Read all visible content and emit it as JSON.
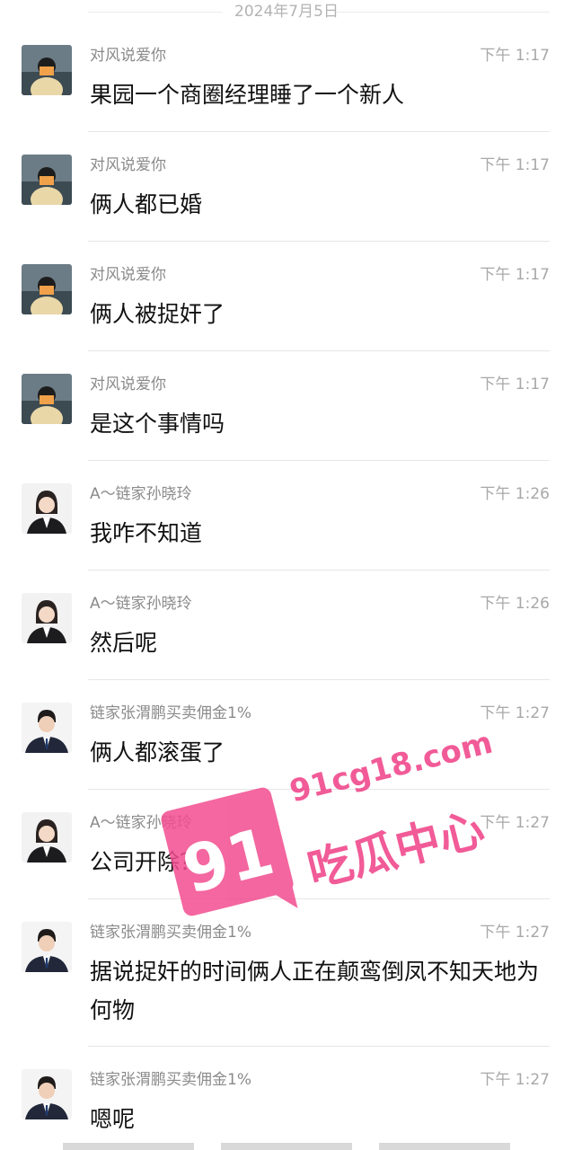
{
  "date_divider": "2024年7月5日",
  "messages": [
    {
      "sender": "对风说爱你",
      "time": "下午 1:17",
      "text": "果园一个商圈经理睡了一个新人",
      "avatar": "boy-avatar"
    },
    {
      "sender": "对风说爱你",
      "time": "下午 1:17",
      "text": "俩人都已婚",
      "avatar": "boy-avatar"
    },
    {
      "sender": "对风说爱你",
      "time": "下午 1:17",
      "text": "俩人被捉奸了",
      "avatar": "boy-avatar"
    },
    {
      "sender": "对风说爱你",
      "time": "下午 1:17",
      "text": "是这个事情吗",
      "avatar": "boy-avatar"
    },
    {
      "sender": "A～链家孙晓玲",
      "time": "下午 1:26",
      "text": "我咋不知道",
      "avatar": "woman-avatar"
    },
    {
      "sender": "A～链家孙晓玲",
      "time": "下午 1:26",
      "text": "然后呢",
      "avatar": "woman-avatar"
    },
    {
      "sender": "链家张渭鹏买卖佣金1%",
      "time": "下午 1:27",
      "text": "俩人都滚蛋了",
      "avatar": "man-avatar"
    },
    {
      "sender": "A～链家孙晓玲",
      "time": "下午 1:27",
      "text": "公司开除？",
      "avatar": "woman-avatar"
    },
    {
      "sender": "链家张渭鹏买卖佣金1%",
      "time": "下午 1:27",
      "text": "据说捉奸的时间俩人正在颠鸾倒凤不知天地为何物",
      "avatar": "man-avatar"
    },
    {
      "sender": "链家张渭鹏买卖佣金1%",
      "time": "下午 1:27",
      "text": "嗯呢",
      "avatar": "man-avatar"
    }
  ],
  "watermark": {
    "number": "91",
    "domain": "91cg18.com",
    "tagline": "吃瓜中心",
    "color": "#f24c8f"
  }
}
